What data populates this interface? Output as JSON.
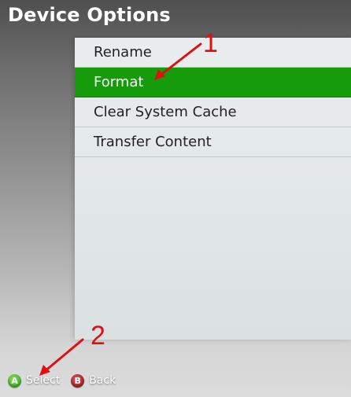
{
  "header": {
    "title": "Device Options"
  },
  "menu": {
    "items": [
      {
        "label": "Rename",
        "selected": false
      },
      {
        "label": "Format",
        "selected": true
      },
      {
        "label": "Clear System Cache",
        "selected": false
      },
      {
        "label": "Transfer Content",
        "selected": false
      }
    ]
  },
  "footer": {
    "select": {
      "glyph": "A",
      "label": "Select"
    },
    "back": {
      "glyph": "B",
      "label": "Back"
    }
  },
  "annotations": {
    "marker_1": "1",
    "marker_2": "2",
    "color": "#e01010"
  },
  "colors": {
    "selected": "#169c0a",
    "a_button": "#3a9e1e",
    "b_button": "#8d1818"
  }
}
